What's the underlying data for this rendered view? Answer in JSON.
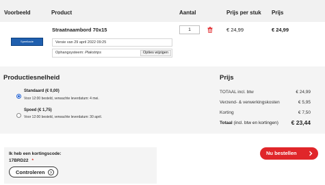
{
  "table": {
    "headers": {
      "preview": "Voorbeeld",
      "product": "Product",
      "quantity": "Aantal",
      "unit_price": "Prijs per stuk",
      "price": "Prijs"
    }
  },
  "item": {
    "thumbnail_text": "Speelkade",
    "name": "Straatnaambord 70x15",
    "version": "Versie van 29 april 2022 09:25",
    "mount_label": "Ophangsysteem:",
    "mount_value": "Plakstrips",
    "options_button": "Opties wijzigen",
    "quantity": "1",
    "unit_price": "€ 24,99",
    "total_price": "€ 24,99"
  },
  "production": {
    "title": "Productiesnelheid",
    "options": [
      {
        "title": "Standaard (€ 0,00)",
        "note": "Voor 12:00 besteld, verwachte leverdatum: 4 mei.",
        "selected": true
      },
      {
        "title": "Spoed (€ 1,75)",
        "note": "Voor 12:00 besteld, verwachte leverdatum: 30 april.",
        "selected": false
      }
    ]
  },
  "summary": {
    "title": "Prijs",
    "rows": [
      {
        "label": "TOTAAL incl. btw",
        "value": "€ 24,99"
      },
      {
        "label": "Verzend- & verwerkingskosten",
        "value": "€ 5,95"
      },
      {
        "label": "Korting",
        "value": "€ 7,50"
      }
    ],
    "total_label": "Totaal",
    "total_suffix": "(incl. btw en kortingen)",
    "total_value": "€ 23,44"
  },
  "discount": {
    "label": "Ik heb een kortingscode:",
    "code": "17BRD22",
    "check_button": "Controleren"
  },
  "order_button": "Nu bestellen",
  "colors": {
    "accent_red": "#e0262a",
    "thumbnail_blue": "#1f5fae",
    "radio_blue": "#1a5cd1"
  }
}
